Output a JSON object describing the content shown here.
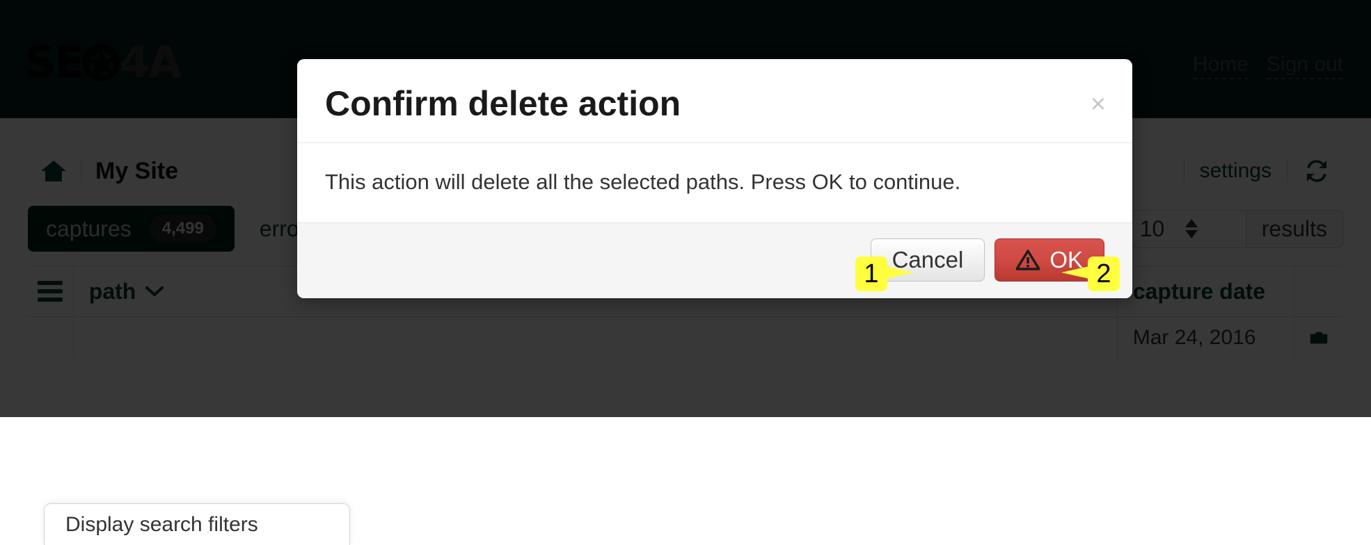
{
  "header": {
    "logo_primary": "SE",
    "logo_aperture_icon": "aperture-icon",
    "logo_secondary": "4A",
    "nav": [
      {
        "label": "Home",
        "name": "home"
      },
      {
        "label": "Sign out",
        "name": "sign-out"
      }
    ]
  },
  "toolbar": {
    "home_icon": "home-icon",
    "site_name": "My Site",
    "settings_label": "settings",
    "refresh_icon": "refresh-icon"
  },
  "tabs": [
    {
      "label": "captures",
      "badge": "4,499",
      "active": true
    },
    {
      "label": "errors",
      "badge": "",
      "active": false
    }
  ],
  "results": {
    "value": "10",
    "addon_label": "results"
  },
  "table": {
    "menu_icon": "hamburger-icon",
    "columns": [
      {
        "label": "path",
        "sort_icon": "chevron-down-icon"
      },
      {
        "label": "capture date"
      }
    ],
    "rows": [
      {
        "path": "",
        "capture_date": "Mar 24, 2016",
        "camera_icon": "camera-icon"
      }
    ]
  },
  "filter_popover": {
    "label": "Display search filters"
  },
  "modal": {
    "title": "Confirm delete action",
    "close_label": "×",
    "body": "This action will delete all the selected paths. Press OK to continue.",
    "cancel_label": "Cancel",
    "ok_label": "OK",
    "ok_icon": "warning-triangle-icon"
  },
  "markers": [
    {
      "number": "1",
      "target": "cancel-button"
    },
    {
      "number": "2",
      "target": "ok-button"
    }
  ],
  "colors": {
    "header_bg": "#01231c",
    "brand_green": "#0a4034",
    "danger_red": "#d9534f",
    "marker_yellow": "#ffff40"
  }
}
